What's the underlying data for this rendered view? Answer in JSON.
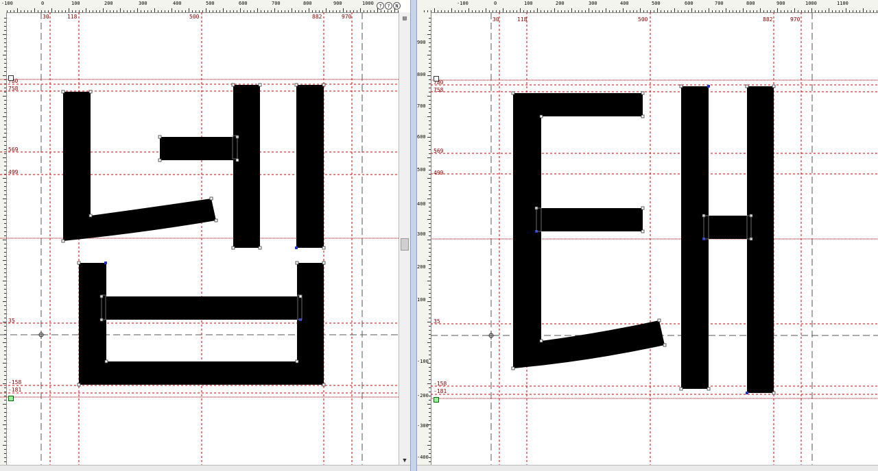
{
  "panes": [
    {
      "id": "left",
      "ruler_labels": [
        "-100",
        "0",
        "100",
        "200",
        "300",
        "400",
        "500",
        "600",
        "700",
        "800",
        "900",
        "1000"
      ],
      "guide_labels_top": [
        "30",
        "118",
        "500",
        "882",
        "970"
      ],
      "guide_labels_side": [
        "780",
        "758",
        "569",
        "499",
        "35",
        "-158",
        "-181"
      ],
      "ruler_buttons": [
        "?",
        "?",
        "N"
      ],
      "glyph_name": "넵"
    },
    {
      "id": "right",
      "ruler_labels": [
        "-100",
        "0",
        "100",
        "200",
        "300",
        "400",
        "500",
        "600",
        "700",
        "800",
        "900",
        "1000",
        "1100"
      ],
      "guide_labels_top": [
        "30",
        "118",
        "500",
        "882",
        "970"
      ],
      "guide_labels_side": [
        "780",
        "758",
        "569",
        "499",
        "35",
        "-158",
        "-181"
      ],
      "vruler_labels": [
        "900",
        "800",
        "700",
        "600",
        "500",
        "400",
        "300",
        "200",
        "100",
        "0",
        "-100",
        "-200",
        "-300",
        "-400"
      ],
      "glyph_name": "태"
    }
  ],
  "colors": {
    "guide": "#d40000",
    "metric": "#555555",
    "glyph": "#000000"
  }
}
